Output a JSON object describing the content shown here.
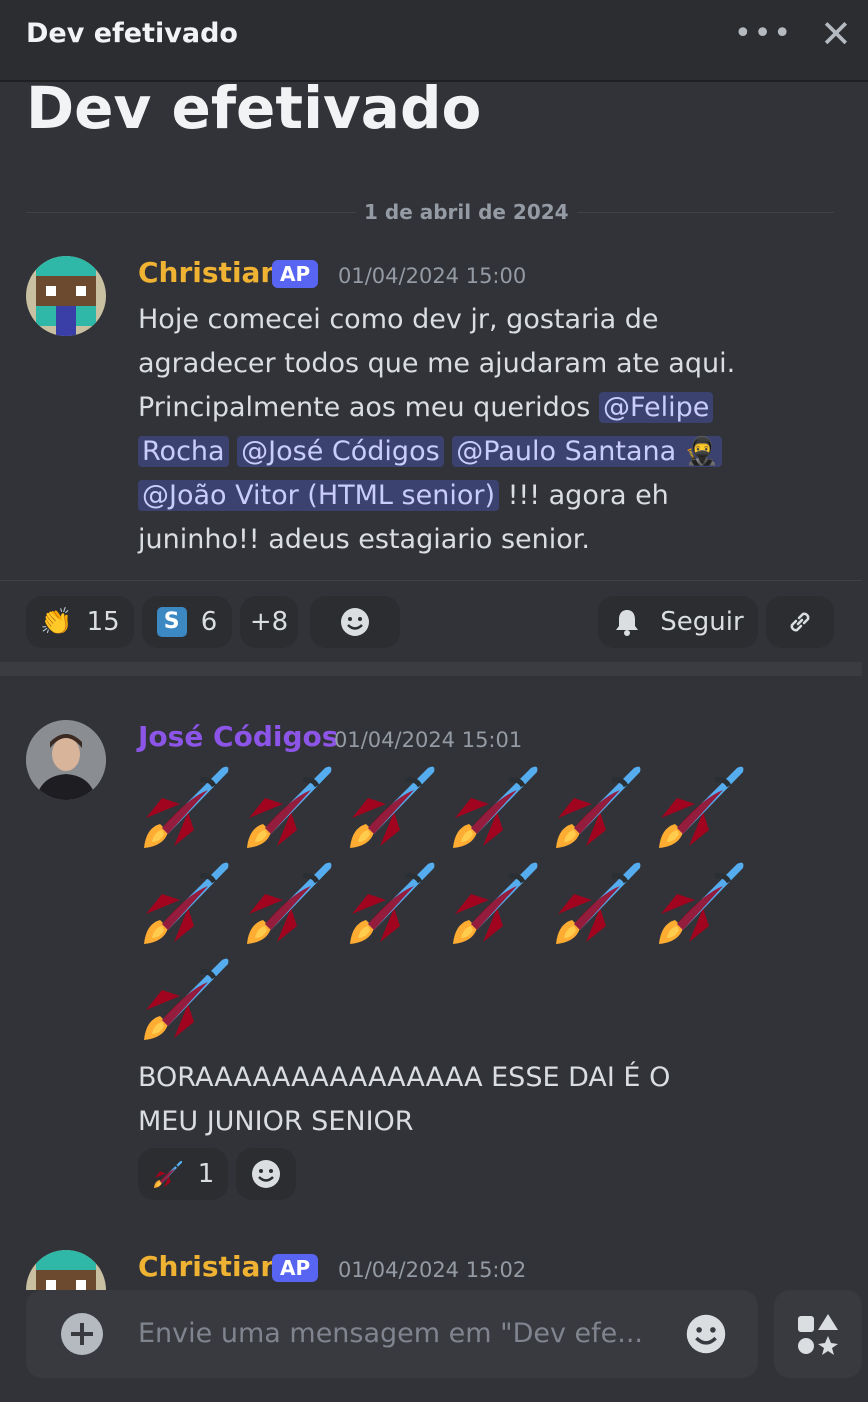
{
  "header": {
    "title": "Dev efetivado"
  },
  "thread": {
    "title": "Dev efetivado",
    "date_divider": "1 de abril de 2024"
  },
  "message1": {
    "author": "Christian",
    "author_color": "#f0b232",
    "tag": "AP",
    "time": "01/04/2024 15:00",
    "line1": "Hoje comecei como dev jr, gostaria de",
    "line2": "agradecer todos que me ajudaram ate aqui.",
    "line3_text": "Principalmente aos meu queridos ",
    "mention1_a": "@Felipe",
    "mention1_b": "Rocha",
    "mention2": "@José Códigos",
    "mention3": "@Paulo Santana",
    "mention4": "@João Vitor (HTML senior)",
    "line5_after": " !!! agora eh",
    "line6": "juninho!! adeus estagiario senior."
  },
  "reactions1": {
    "clap_count": "15",
    "s_letter": "S",
    "s_count": "6",
    "more": "+8",
    "follow_label": "Seguir"
  },
  "message2": {
    "author": "José Códigos",
    "author_color": "#8c55e8",
    "time": "01/04/2024 15:01",
    "rocket_count": 13,
    "line1": "BORAAAAAAAAAAAAAAA ESSE DAI É O",
    "line2": "MEU JUNIOR SENIOR",
    "rocket_reaction_count": "1"
  },
  "message3": {
    "author": "Christian",
    "tag": "AP",
    "time": "01/04/2024 15:02"
  },
  "composer": {
    "placeholder": "Envie uma mensagem em \"Dev efe..."
  },
  "icons": [
    "more-options-icon",
    "close-icon",
    "clap-emoji",
    "smiley-icon",
    "bell-icon",
    "link-icon",
    "rocket-emoji",
    "plus-icon",
    "apps-icon"
  ]
}
